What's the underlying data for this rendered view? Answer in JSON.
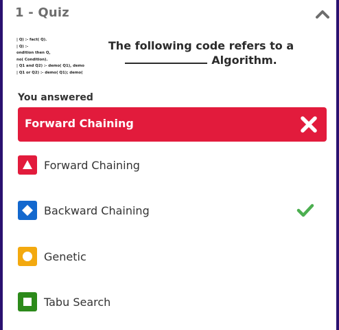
{
  "header": {
    "title": "1 - Quiz",
    "collapse_icon": "chevron-up-icon"
  },
  "question": {
    "code_lines": [
      "| Q) :- fact( Q).",
      "| Q) :-",
      "ondition then Q,",
      "no( Condition).",
      "| Q1 and Q2) :- demo( Q1), demo",
      "| Q1 or Q2) :- demo( Q1); demo("
    ],
    "line1": "The following code refers to a",
    "line2": "Algorithm."
  },
  "response": {
    "heading": "You answered",
    "answer": "Forward Chaining",
    "status_icon": "x-icon",
    "color": "#e21b3c"
  },
  "options": [
    {
      "label": "Forward Chaining",
      "shape": "triangle",
      "color": "#e21b3c",
      "correct": false
    },
    {
      "label": "Backward Chaining",
      "shape": "diamond",
      "color": "#1368ce",
      "correct": true
    },
    {
      "label": "Genetic",
      "shape": "circle",
      "color": "#f3a90f",
      "correct": false
    },
    {
      "label": "Tabu Search",
      "shape": "square",
      "color": "#2c8a1a",
      "correct": false
    }
  ],
  "correct_color": "#4caf50"
}
